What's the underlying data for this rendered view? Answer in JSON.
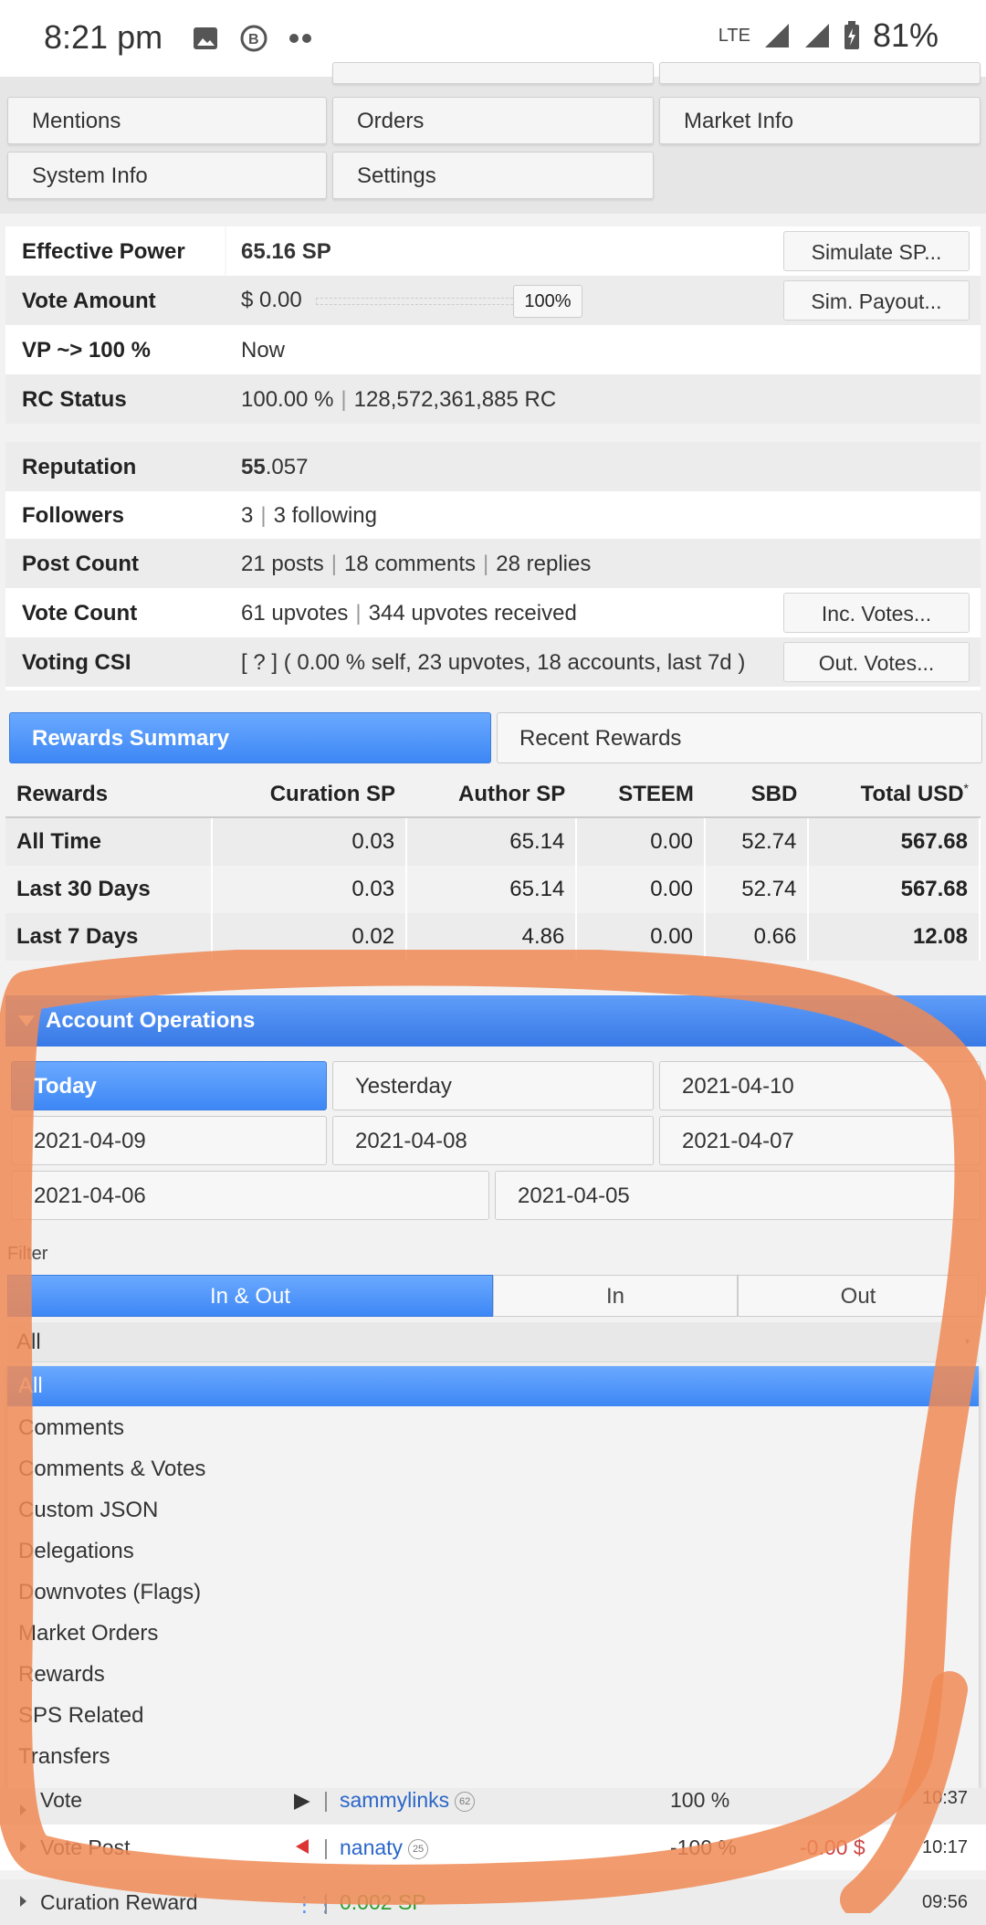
{
  "status_bar": {
    "time": "8:21 pm",
    "network": "LTE",
    "battery": "81%"
  },
  "nav": {
    "row1": [
      "Mentions",
      "Orders",
      "Market Info"
    ],
    "row2": [
      "System Info",
      "Settings"
    ]
  },
  "info": {
    "effective_power": {
      "label": "Effective Power",
      "value": "65.16 SP",
      "button": "Simulate SP..."
    },
    "vote_amount": {
      "label": "Vote Amount",
      "value": "$ 0.00",
      "slider": "100%",
      "button": "Sim. Payout..."
    },
    "vp": {
      "label": "VP ~> 100 %",
      "value": "Now"
    },
    "rc": {
      "label": "RC Status",
      "percent": "100.00 %",
      "amount": "128,572,361,885 RC"
    },
    "reputation": {
      "label": "Reputation",
      "int": "55",
      "dec": ".057"
    },
    "followers": {
      "label": "Followers",
      "count": "3",
      "following": "3 following"
    },
    "post_count": {
      "label": "Post Count",
      "posts": "21 posts",
      "comments": "18 comments",
      "replies": "28 replies"
    },
    "vote_count": {
      "label": "Vote Count",
      "upvotes": "61 upvotes",
      "received": "344 upvotes received",
      "button": "Inc. Votes..."
    },
    "voting_csi": {
      "label": "Voting CSI",
      "value": "[ ? ] ( 0.00 % self, 23 upvotes, 18 accounts, last 7d )",
      "button": "Out. Votes..."
    }
  },
  "reward_tabs": {
    "active": "Rewards Summary",
    "inactive": "Recent Rewards"
  },
  "rewards": {
    "headers": [
      "Rewards",
      "Curation SP",
      "Author SP",
      "STEEM",
      "SBD",
      "Total USD",
      "*"
    ],
    "rows": [
      [
        "All Time",
        "0.03",
        "65.14",
        "0.00",
        "52.74",
        "567.68"
      ],
      [
        "Last 30 Days",
        "0.03",
        "65.14",
        "0.00",
        "52.74",
        "567.68"
      ],
      [
        "Last 7 Days",
        "0.02",
        "4.86",
        "0.00",
        "0.66",
        "12.08"
      ]
    ]
  },
  "account_ops": {
    "title": "Account Operations",
    "dates": [
      "Today",
      "Yesterday",
      "2021-04-10",
      "2021-04-09",
      "2021-04-08",
      "2021-04-07",
      "2021-04-06",
      "2021-04-05"
    ],
    "filter_label": "Filter",
    "filter_tabs": [
      "In & Out",
      "In",
      "Out"
    ],
    "select_value": "All",
    "options": [
      "All",
      "Comments",
      "Comments & Votes",
      "Custom JSON",
      "Delegations",
      "Downvotes (Flags)",
      "Market Orders",
      "Rewards",
      "SPS Related",
      "Transfers"
    ]
  },
  "operations": [
    {
      "type": "Vote",
      "user": "sammylinks",
      "rep": "62",
      "pct": "100 %",
      "amount": "",
      "time": "10:37"
    },
    {
      "type": "Vote Post",
      "user": "nanaty",
      "rep": "25",
      "pct": "-100 %",
      "amount": "-0.00 $",
      "time": "10:17"
    },
    {
      "type": "Curation Reward",
      "user": "0.002 SP",
      "rep": "",
      "pct": "",
      "amount": "",
      "time": "09:56"
    }
  ],
  "colors": {
    "accent": "#4a90f5",
    "annotation": "#f08a55"
  }
}
